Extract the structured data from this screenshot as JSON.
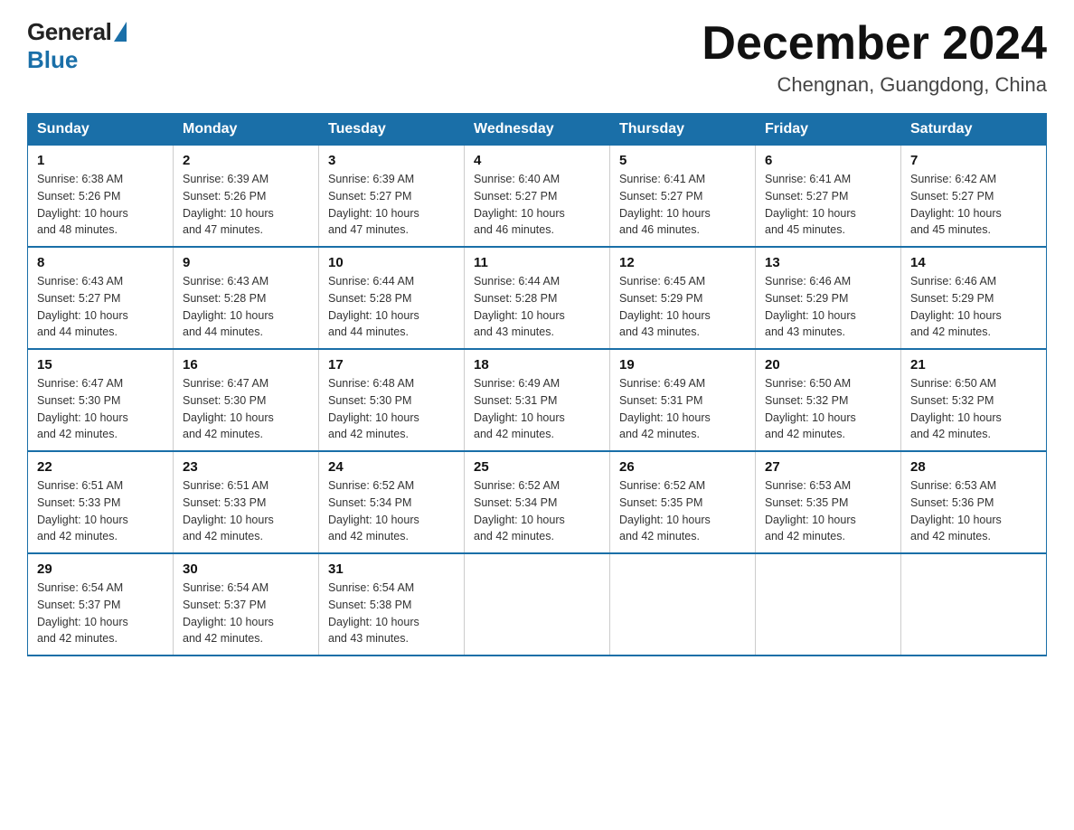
{
  "logo": {
    "general": "General",
    "blue": "Blue"
  },
  "title": "December 2024",
  "location": "Chengnan, Guangdong, China",
  "days_of_week": [
    "Sunday",
    "Monday",
    "Tuesday",
    "Wednesday",
    "Thursday",
    "Friday",
    "Saturday"
  ],
  "weeks": [
    [
      {
        "day": "1",
        "sunrise": "6:38 AM",
        "sunset": "5:26 PM",
        "daylight": "10 hours and 48 minutes."
      },
      {
        "day": "2",
        "sunrise": "6:39 AM",
        "sunset": "5:26 PM",
        "daylight": "10 hours and 47 minutes."
      },
      {
        "day": "3",
        "sunrise": "6:39 AM",
        "sunset": "5:27 PM",
        "daylight": "10 hours and 47 minutes."
      },
      {
        "day": "4",
        "sunrise": "6:40 AM",
        "sunset": "5:27 PM",
        "daylight": "10 hours and 46 minutes."
      },
      {
        "day": "5",
        "sunrise": "6:41 AM",
        "sunset": "5:27 PM",
        "daylight": "10 hours and 46 minutes."
      },
      {
        "day": "6",
        "sunrise": "6:41 AM",
        "sunset": "5:27 PM",
        "daylight": "10 hours and 45 minutes."
      },
      {
        "day": "7",
        "sunrise": "6:42 AM",
        "sunset": "5:27 PM",
        "daylight": "10 hours and 45 minutes."
      }
    ],
    [
      {
        "day": "8",
        "sunrise": "6:43 AM",
        "sunset": "5:27 PM",
        "daylight": "10 hours and 44 minutes."
      },
      {
        "day": "9",
        "sunrise": "6:43 AM",
        "sunset": "5:28 PM",
        "daylight": "10 hours and 44 minutes."
      },
      {
        "day": "10",
        "sunrise": "6:44 AM",
        "sunset": "5:28 PM",
        "daylight": "10 hours and 44 minutes."
      },
      {
        "day": "11",
        "sunrise": "6:44 AM",
        "sunset": "5:28 PM",
        "daylight": "10 hours and 43 minutes."
      },
      {
        "day": "12",
        "sunrise": "6:45 AM",
        "sunset": "5:29 PM",
        "daylight": "10 hours and 43 minutes."
      },
      {
        "day": "13",
        "sunrise": "6:46 AM",
        "sunset": "5:29 PM",
        "daylight": "10 hours and 43 minutes."
      },
      {
        "day": "14",
        "sunrise": "6:46 AM",
        "sunset": "5:29 PM",
        "daylight": "10 hours and 42 minutes."
      }
    ],
    [
      {
        "day": "15",
        "sunrise": "6:47 AM",
        "sunset": "5:30 PM",
        "daylight": "10 hours and 42 minutes."
      },
      {
        "day": "16",
        "sunrise": "6:47 AM",
        "sunset": "5:30 PM",
        "daylight": "10 hours and 42 minutes."
      },
      {
        "day": "17",
        "sunrise": "6:48 AM",
        "sunset": "5:30 PM",
        "daylight": "10 hours and 42 minutes."
      },
      {
        "day": "18",
        "sunrise": "6:49 AM",
        "sunset": "5:31 PM",
        "daylight": "10 hours and 42 minutes."
      },
      {
        "day": "19",
        "sunrise": "6:49 AM",
        "sunset": "5:31 PM",
        "daylight": "10 hours and 42 minutes."
      },
      {
        "day": "20",
        "sunrise": "6:50 AM",
        "sunset": "5:32 PM",
        "daylight": "10 hours and 42 minutes."
      },
      {
        "day": "21",
        "sunrise": "6:50 AM",
        "sunset": "5:32 PM",
        "daylight": "10 hours and 42 minutes."
      }
    ],
    [
      {
        "day": "22",
        "sunrise": "6:51 AM",
        "sunset": "5:33 PM",
        "daylight": "10 hours and 42 minutes."
      },
      {
        "day": "23",
        "sunrise": "6:51 AM",
        "sunset": "5:33 PM",
        "daylight": "10 hours and 42 minutes."
      },
      {
        "day": "24",
        "sunrise": "6:52 AM",
        "sunset": "5:34 PM",
        "daylight": "10 hours and 42 minutes."
      },
      {
        "day": "25",
        "sunrise": "6:52 AM",
        "sunset": "5:34 PM",
        "daylight": "10 hours and 42 minutes."
      },
      {
        "day": "26",
        "sunrise": "6:52 AM",
        "sunset": "5:35 PM",
        "daylight": "10 hours and 42 minutes."
      },
      {
        "day": "27",
        "sunrise": "6:53 AM",
        "sunset": "5:35 PM",
        "daylight": "10 hours and 42 minutes."
      },
      {
        "day": "28",
        "sunrise": "6:53 AM",
        "sunset": "5:36 PM",
        "daylight": "10 hours and 42 minutes."
      }
    ],
    [
      {
        "day": "29",
        "sunrise": "6:54 AM",
        "sunset": "5:37 PM",
        "daylight": "10 hours and 42 minutes."
      },
      {
        "day": "30",
        "sunrise": "6:54 AM",
        "sunset": "5:37 PM",
        "daylight": "10 hours and 42 minutes."
      },
      {
        "day": "31",
        "sunrise": "6:54 AM",
        "sunset": "5:38 PM",
        "daylight": "10 hours and 43 minutes."
      },
      null,
      null,
      null,
      null
    ]
  ],
  "labels": {
    "sunrise": "Sunrise:",
    "sunset": "Sunset:",
    "daylight": "Daylight:"
  }
}
